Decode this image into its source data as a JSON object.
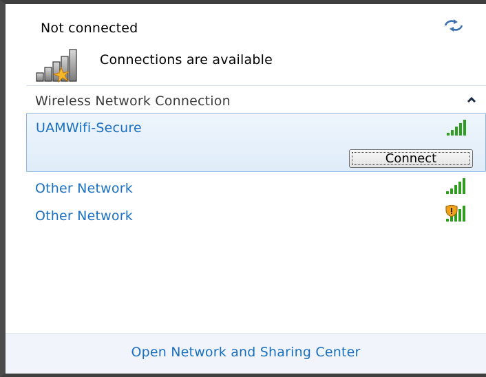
{
  "status": {
    "title": "Not connected",
    "availability_text": "Connections are available",
    "refresh_icon": "refresh-arrows-icon",
    "availability_icon": "signal-bars-with-star-icon"
  },
  "section": {
    "label": "Wireless Network Connection",
    "collapse_icon": "chevron-up-icon"
  },
  "networks": [
    {
      "name": "UAMWifi-Secure",
      "selected": true,
      "icon": "signal-strength-icon",
      "secured": true
    },
    {
      "name": "Other Network",
      "selected": false,
      "icon": "signal-strength-icon",
      "secured": true
    },
    {
      "name": "Other Network",
      "selected": false,
      "icon": "signal-strength-shield-icon",
      "secured": false
    }
  ],
  "connect_button": {
    "label": "Connect",
    "mnemonic": "C"
  },
  "footer": {
    "link_label": "Open Network and Sharing Center"
  },
  "colors": {
    "link_blue": "#1a6fc0",
    "signal_green": "#2f9e1e",
    "selection_bg": "#dfecf9",
    "selection_border": "#8eb7e2",
    "footer_bg": "#f1f5fb"
  }
}
